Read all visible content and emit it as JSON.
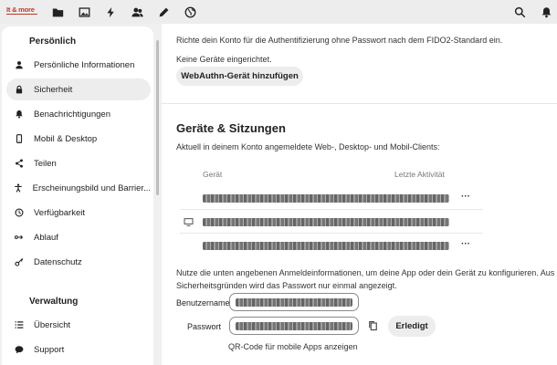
{
  "topbar": {
    "logo": "It & more",
    "nav_icons": [
      "folder-icon",
      "image-icon",
      "activity-icon",
      "contacts-icon",
      "pencil-icon",
      "globe-icon"
    ],
    "right_icons": [
      "search-icon",
      "bell-icon"
    ]
  },
  "sidebar": {
    "personal_heading": "Persönlich",
    "personal_items": [
      {
        "label": "Persönliche Informationen",
        "icon": "user-icon"
      },
      {
        "label": "Sicherheit",
        "icon": "lock-icon",
        "active": true
      },
      {
        "label": "Benachrichtigungen",
        "icon": "bell-icon"
      },
      {
        "label": "Mobil & Desktop",
        "icon": "phone-icon"
      },
      {
        "label": "Teilen",
        "icon": "share-icon"
      },
      {
        "label": "Erscheinungsbild und Barrier...",
        "icon": "accessibility-icon"
      },
      {
        "label": "Verfügbarkeit",
        "icon": "clock-icon"
      },
      {
        "label": "Ablauf",
        "icon": "flow-icon"
      },
      {
        "label": "Datenschutz",
        "icon": "key-icon"
      }
    ],
    "admin_heading": "Verwaltung",
    "admin_items": [
      {
        "label": "Übersicht",
        "icon": "list-icon"
      },
      {
        "label": "Support",
        "icon": "chat-icon"
      }
    ]
  },
  "webauthn": {
    "description": "Richte dein Konto für die Authentifizierung ohne Passwort nach dem FIDO2-Standard ein.",
    "no_devices": "Keine Geräte eingerichtet.",
    "add_button": "WebAuthn-Gerät hinzufügen"
  },
  "devices": {
    "title": "Geräte & Sitzungen",
    "description": "Aktuell in deinem Konto angemeldete Web-, Desktop- und Mobil-Clients:",
    "col_device": "Gerät",
    "col_activity": "Letzte Aktivität",
    "rows_menu": "···"
  },
  "app_password": {
    "instructions_line1": "Nutze die unten angebenen Anmeldeinformationen, um deine App oder dein Gerät zu konfigurieren. Aus",
    "instructions_line2": "Sicherheitsgründen wird das Passwort nur einmal angezeigt.",
    "username_label": "Benutzername",
    "password_label": "Passwort",
    "done_button": "Erledigt",
    "qr_link": "QR-Code für mobile Apps anzeigen"
  }
}
